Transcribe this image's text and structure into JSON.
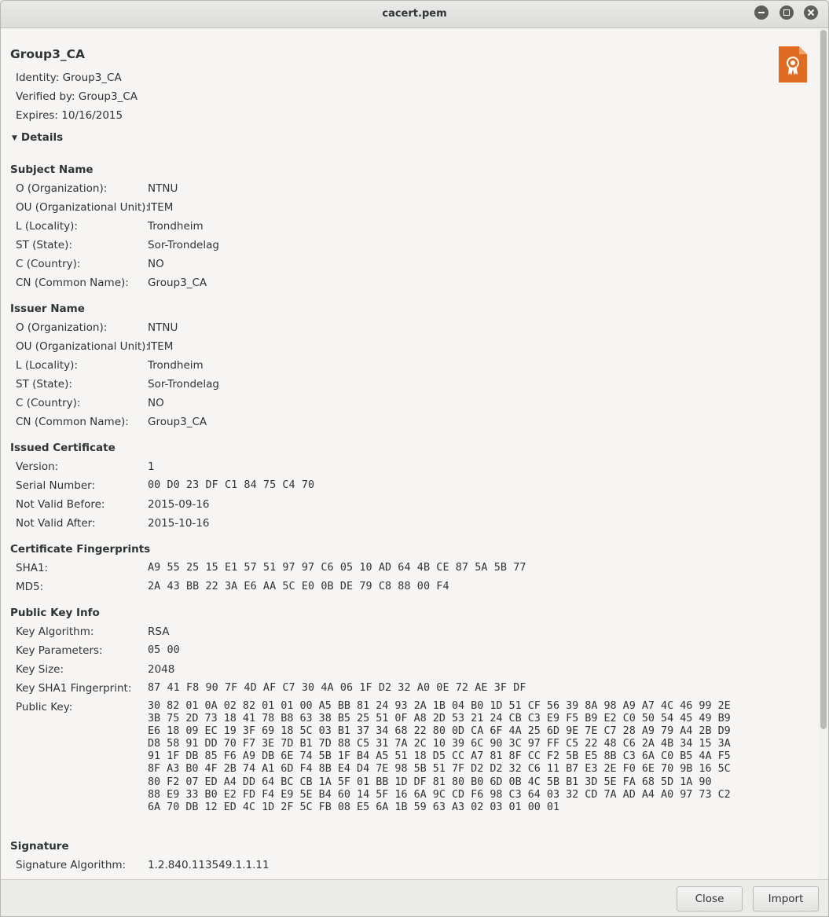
{
  "window": {
    "title": "cacert.pem"
  },
  "cert": {
    "name": "Group3_CA",
    "identity": "Identity: Group3_CA",
    "verified_by": "Verified by: Group3_CA",
    "expires": "Expires: 10/16/2015",
    "details_label": "Details",
    "icon": "certificate-icon",
    "icon_color": "#e06c23"
  },
  "sections": {
    "subject": {
      "title": "Subject Name",
      "rows": [
        {
          "label": "O (Organization):",
          "value": "NTNU"
        },
        {
          "label": "OU (Organizational Unit):",
          "value": "ITEM"
        },
        {
          "label": "L (Locality):",
          "value": "Trondheim"
        },
        {
          "label": "ST (State):",
          "value": "Sor-Trondelag"
        },
        {
          "label": "C (Country):",
          "value": "NO"
        },
        {
          "label": "CN (Common Name):",
          "value": "Group3_CA"
        }
      ]
    },
    "issuer": {
      "title": "Issuer Name",
      "rows": [
        {
          "label": "O (Organization):",
          "value": "NTNU"
        },
        {
          "label": "OU (Organizational Unit):",
          "value": "ITEM"
        },
        {
          "label": "L (Locality):",
          "value": "Trondheim"
        },
        {
          "label": "ST (State):",
          "value": "Sor-Trondelag"
        },
        {
          "label": "C (Country):",
          "value": "NO"
        },
        {
          "label": "CN (Common Name):",
          "value": "Group3_CA"
        }
      ]
    },
    "issued": {
      "title": "Issued Certificate",
      "rows": [
        {
          "label": "Version:",
          "value": "1"
        },
        {
          "label": "Serial Number:",
          "value": "00 D0 23 DF C1 84 75 C4 70"
        },
        {
          "label": "Not Valid Before:",
          "value": "2015-09-16"
        },
        {
          "label": "Not Valid After:",
          "value": "2015-10-16"
        }
      ]
    },
    "fingerprints": {
      "title": "Certificate Fingerprints",
      "rows": [
        {
          "label": "SHA1:",
          "value": "A9 55 25 15 E1 57 51 97 97 C6 05 10 AD 64 4B CE 87 5A 5B 77"
        },
        {
          "label": "MD5:",
          "value": "2A 43 BB 22 3A E6 AA 5C E0 0B DE 79 C8 88 00 F4"
        }
      ]
    },
    "pubkey": {
      "title": "Public Key Info",
      "rows": [
        {
          "label": "Key Algorithm:",
          "value": "RSA"
        },
        {
          "label": "Key Parameters:",
          "value": "05 00"
        },
        {
          "label": "Key Size:",
          "value": "2048"
        },
        {
          "label": "Key SHA1 Fingerprint:",
          "value": "87 41 F8 90 7F 4D AF C7 30 4A 06 1F D2 32 A0 0E 72 AE 3F DF"
        }
      ],
      "public_key_label": "Public Key:",
      "public_key_lines": [
        "30 82 01 0A 02 82 01 01 00 A5 BB 81 24 93 2A 1B 04 B0 1D 51 CF 56 39 8A 98 A9 A7 4C 46 99 2E",
        "3B 75 2D 73 18 41 78 B8 63 38 B5 25 51 0F A8 2D 53 21 24 CB C3 E9 F5 B9 E2 C0 50 54 45 49 B9",
        "E6 18 09 EC 19 3F 69 18 5C 03 B1 37 34 68 22 80 0D CA 6F 4A 25 6D 9E 7E C7 28 A9 79 A4 2B D9",
        "D8 58 91 DD 70 F7 3E 7D B1 7D 88 C5 31 7A 2C 10 39 6C 90 3C 97 FF C5 22 48 C6 2A 4B 34 15 3A",
        "91 1F DB 85 F6 A9 DB 6E 74 5B 1F B4 A5 51 18 D5 CC A7 81 8F CC F2 5B E5 8B C3 6A C0 B5 4A F5",
        "8F A3 B0 4F 2B 74 A1 6D F4 8B E4 D4 7E 98 5B 51 7F D2 D2 32 C6 11 B7 E3 2E F0 6E 70 9B 16 5C",
        "80 F2 07 ED A4 DD 64 BC CB 1A 5F 01 BB 1D DF 81 80 B0 6D 0B 4C 5B B1 3D 5E FA 68 5D 1A 90",
        "88 E9 33 B0 E2 FD F4 E9 5E B4 60 14 5F 16 6A 9C CD F6 98 C3 64 03 32 CD 7A AD A4 A0 97 73 C2",
        "6A 70 DB 12 ED 4C 1D 2F 5C FB 08 E5 6A 1B 59 63 A3 02 03 01 00 01"
      ]
    },
    "signature": {
      "title": "Signature",
      "rows": [
        {
          "label": "Signature Algorithm:",
          "value": "1.2.840.113549.1.1.11"
        }
      ]
    }
  },
  "footer": {
    "close_label": "Close",
    "import_label": "Import"
  }
}
